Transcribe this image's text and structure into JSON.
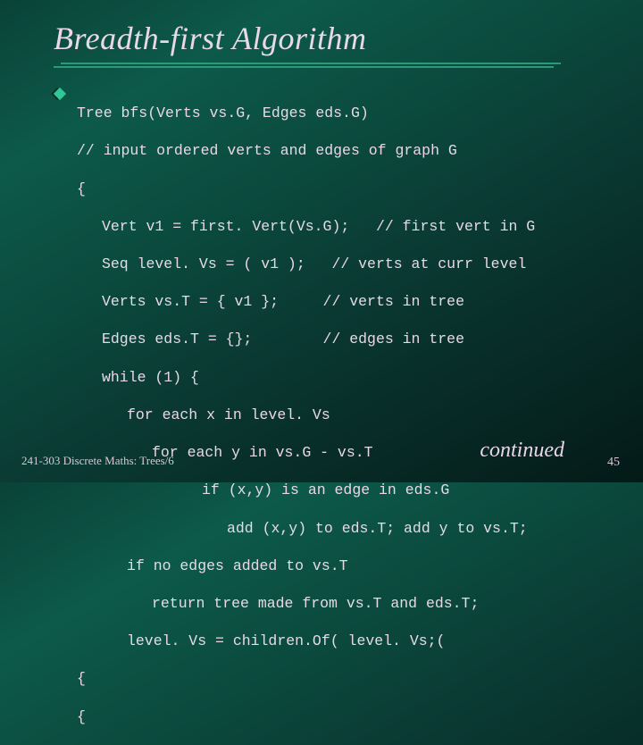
{
  "title": "Breadth-first Algorithm",
  "code": {
    "l1": "Tree bfs(Verts vs.G, Edges eds.G)",
    "l2": "// input ordered verts and edges of graph G",
    "l3": "{",
    "l4": "Vert v1 = first. Vert(Vs.G);   // first vert in G",
    "l5": "Seq level. Vs = ( v1 );   // verts at curr level",
    "l6": "Verts vs.T = { v1 };     // verts in tree",
    "l7": "Edges eds.T = {};        // edges in tree",
    "l8": "while (1) {",
    "l9": "for each x in level. Vs",
    "l10": "for each y in vs.G - vs.T",
    "l11": "if (x,y) is an edge in eds.G",
    "l12": "add (x,y) to eds.T; add y to vs.T;",
    "l13": "if no edges added to vs.T",
    "l14": "return tree made from vs.T and eds.T;",
    "l15": "level. Vs = children.Of( level. Vs;(",
    "l16": "{",
    "l17": "{"
  },
  "footer": "241-303 Discrete Maths: Trees/6",
  "continued": "continued",
  "pagenum": "45"
}
